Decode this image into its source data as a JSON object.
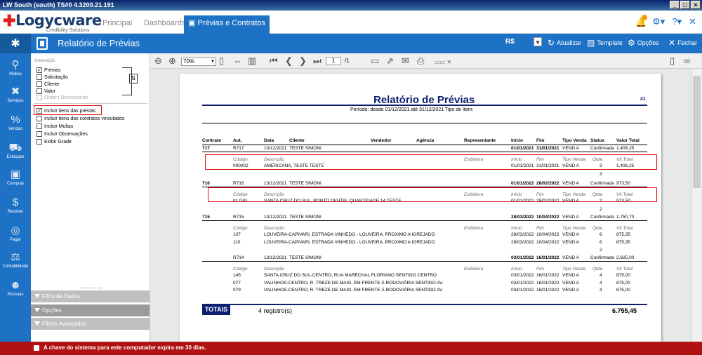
{
  "window": {
    "title": "LW South (south) TS#0 4.3200.21.191"
  },
  "logo": {
    "name": "Logycware",
    "tagline": "Credibility Solutions"
  },
  "nav": {
    "tabs": [
      {
        "label": "Principal"
      },
      {
        "label": "Dashboards"
      },
      {
        "label": "Prévias e Contratos"
      }
    ]
  },
  "toolbar": {
    "title": "Relatório de Prévias",
    "currency": "R$",
    "actions": {
      "refresh": "Atualizar",
      "template": "Template",
      "options": "Opções",
      "close": "Fechar"
    }
  },
  "sidebar": {
    "items": [
      {
        "label": "Mídias",
        "icon": "map-pin-icon"
      },
      {
        "label": "Serviços",
        "icon": "tools-icon"
      },
      {
        "label": "Vendas",
        "icon": "percent-icon"
      },
      {
        "label": "Estoques",
        "icon": "hand-truck-icon"
      },
      {
        "label": "Compras",
        "icon": "box-icon"
      },
      {
        "label": "Receber",
        "icon": "coin-icon"
      },
      {
        "label": "Pagar",
        "icon": "coins-icon"
      },
      {
        "label": "Contabilidade",
        "icon": "scale-icon"
      },
      {
        "label": "Pessoas",
        "icon": "people-icon"
      }
    ]
  },
  "panel": {
    "ordering": {
      "label": "Ordenação",
      "items": [
        {
          "label": "Prévias",
          "checked": true
        },
        {
          "label": "Solicitação",
          "checked": false
        },
        {
          "label": "Cliente",
          "checked": false
        },
        {
          "label": "Valor",
          "checked": false
        }
      ],
      "desc": "Ordem Decrescente"
    },
    "options": [
      {
        "label": "Incluir itens das prévias",
        "checked": true
      },
      {
        "label": "Incluir itens dos contratos vinculados",
        "checked": false
      },
      {
        "label": "Incluir Multas",
        "checked": false
      },
      {
        "label": "Incluir Observações",
        "checked": false
      },
      {
        "label": "Exibir Grade",
        "checked": false
      }
    ],
    "accordion": [
      "Filtro de Dados",
      "Opções",
      "Filtros Avançados"
    ]
  },
  "viewer": {
    "zoom": "70%",
    "page": "1",
    "pages": "/1"
  },
  "report": {
    "title": "Relatório de Prévias",
    "number": "#1",
    "period": "Período: desde 01/12/2021 até 31/12/2021   Tipo de Item:",
    "headers": {
      "contrato": "Contrato",
      "aut": "Aut.",
      "data": "Data",
      "cliente": "Cliente",
      "vendedor": "Vendedor",
      "agencia": "Agência",
      "representante": "Representante",
      "inicio": "Início",
      "fim": "Fim",
      "tipo": "Tipo Venda",
      "status": "Status",
      "valor": "Valor Total"
    },
    "sub": {
      "codigo": "Código",
      "descricao": "Descrição",
      "exibidora": "Exibidora",
      "inicio": "Início",
      "fim": "Fim",
      "tipo": "Tipo Venda",
      "qtde": "Qtde.",
      "vlr": "Vlr.Total"
    },
    "records": [
      {
        "contrato": "717",
        "aut": "R717",
        "data": "13/12/2021",
        "cliente": "TESTE SIMONI",
        "inicio": "01/01/2021",
        "fim": "31/01/2021",
        "tipo": "VEND A",
        "status": "Confirmada",
        "valor": "1.406,25",
        "items": [
          {
            "codigo": "000002",
            "descricao": "AMERICANA, TESTE TESTE",
            "inicio": "01/01/2021",
            "fim": "31/01/2021",
            "tipo": "VEND A",
            "qtde": "3",
            "vlr": "1.406,25"
          }
        ],
        "qty": "3"
      },
      {
        "contrato": "716",
        "aut": "R716",
        "data": "13/12/2021",
        "cliente": "TESTE SIMONI",
        "inicio": "01/01/2022",
        "fim": "28/02/2022",
        "tipo": "VEND A",
        "status": "Confirmada",
        "valor": "973,50",
        "items": [
          {
            "codigo": "01 DIG",
            "descricao": "SANTA CRUZ DO SUL, PONTO DIGITAL QUANTIDADE 14 TESTE",
            "inicio": "01/01/2022",
            "fim": "28/02/2022",
            "tipo": "VEND A",
            "qtde": "2",
            "vlr": "973,50"
          }
        ],
        "qty": "2"
      },
      {
        "contrato": "715",
        "aut": "R715",
        "data": "13/12/2021",
        "cliente": "TESTE SIMONI",
        "inicio": "28/03/2022",
        "fim": "10/04/2022",
        "tipo": "VEND A",
        "status": "Confirmada",
        "valor": "1.750,70",
        "items": [
          {
            "codigo": "107",
            "descricao": "LOUVEIRA-CAPIVARI, ESTRADA VINHEDO - LOUVEIRA, PROXIMO A IGREJADO",
            "inicio": "28/03/2022",
            "fim": "10/04/2022",
            "tipo": "VEND A",
            "qtde": "6",
            "vlr": "875,35"
          },
          {
            "codigo": "110",
            "descricao": "LOUVEIRA-CAPIVARI, ESTRADA VINHEDO - LOUVEIRA, PROXIMO A IGREJADO",
            "inicio": "28/03/2022",
            "fim": "10/04/2022",
            "tipo": "VEND A",
            "qtde": "6",
            "vlr": "875,35"
          }
        ],
        "qty": "2"
      },
      {
        "contrato": "",
        "aut": "R714",
        "data": "13/12/2021",
        "cliente": "TESTE SIMONI",
        "inicio": "03/01/2022",
        "fim": "16/01/2022",
        "tipo": "VEND A",
        "status": "Confirmada",
        "valor": "2.625,00",
        "items": [
          {
            "codigo": "145",
            "descricao": "SANTA CRUZ DO SUL-CENTRO, RUA MARECHAL FLORIANO SENTIDO CENTRO",
            "inicio": "03/01/2022",
            "fim": "16/01/2022",
            "tipo": "VEND A",
            "qtde": "4",
            "vlr": "875,00"
          },
          {
            "codigo": "077",
            "descricao": "VALINHOS-CENTRO, R. TREZE DE MAIO, EM FRENTE À RODOVIÁRIA SENTIDO AV.",
            "inicio": "03/01/2022",
            "fim": "16/01/2022",
            "tipo": "VEND A",
            "qtde": "4",
            "vlr": "875,00"
          },
          {
            "codigo": "079",
            "descricao": "VALINHOS-CENTRO, R. TREZE DE MAIO, EM FRENTE À RODOVIÁRIA SENTIDO AV.",
            "inicio": "03/01/2022",
            "fim": "16/01/2022",
            "tipo": "VEND A",
            "qtde": "4",
            "vlr": "875,00"
          }
        ],
        "qty": ""
      }
    ],
    "totals": {
      "label": "TOTAIS",
      "records": "4 registro(s)",
      "value": "6.755,45"
    }
  },
  "status": {
    "message": "A chave do sistema para este computador expira em 30 dias."
  }
}
